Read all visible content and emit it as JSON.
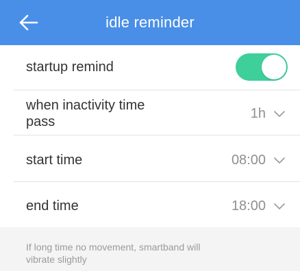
{
  "header": {
    "title": "idle reminder",
    "back_icon": "arrow-left-icon",
    "background_color": "#4a8fe7"
  },
  "settings": {
    "startup_remind": {
      "label": "startup remind",
      "enabled": true,
      "toggle_color": "#3ecf9a"
    },
    "inactivity": {
      "label_line1": "when inactivity time",
      "label_line2": "pass",
      "value": "1h",
      "icon": "chevron-down-icon"
    },
    "start_time": {
      "label": "start time",
      "value": "08:00",
      "icon": "chevron-down-icon"
    },
    "end_time": {
      "label": "end time",
      "value": "18:00",
      "icon": "chevron-down-icon"
    }
  },
  "footer": {
    "note_line1": "If long time no movement, smartband will",
    "note_line2": "vibrate slightly"
  }
}
